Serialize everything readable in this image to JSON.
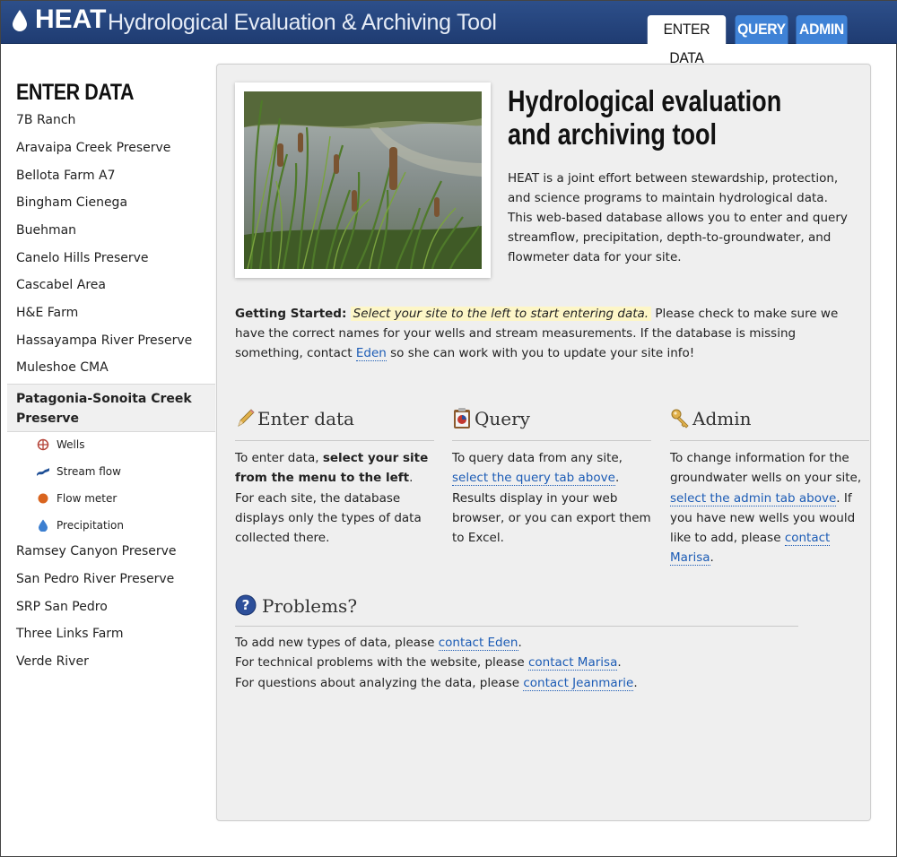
{
  "header": {
    "logo_text": "HEAT",
    "subtitle": "Hydrological Evaluation & Archiving Tool",
    "tabs": [
      {
        "label": "ENTER DATA",
        "active": true
      },
      {
        "label": "QUERY",
        "active": false
      },
      {
        "label": "ADMIN",
        "active": false
      }
    ],
    "bg_color": "#244580",
    "tab_color": "#3f82d6"
  },
  "sidebar": {
    "heading": "ENTER DATA",
    "items_before": [
      "7B Ranch",
      "Aravaipa Creek Preserve",
      "Bellota Farm A7",
      "Bingham Cienega",
      "Buehman",
      "Canelo Hills Preserve",
      "Cascabel Area",
      "H&E Farm",
      "Hassayampa River Preserve",
      "Muleshoe CMA"
    ],
    "active_item": "Patagonia-Sonoita Creek Preserve",
    "sub_items": [
      {
        "label": "Wells",
        "icon": "crosshair-circle-icon"
      },
      {
        "label": "Stream flow",
        "icon": "stream-icon"
      },
      {
        "label": "Flow meter",
        "icon": "orange-dot-icon"
      },
      {
        "label": "Precipitation",
        "icon": "raindrop-icon"
      }
    ],
    "items_after": [
      "Ramsey Canyon Preserve",
      "San Pedro River Preserve",
      "SRP San Pedro",
      "Three Links Farm",
      "Verde River"
    ]
  },
  "main": {
    "title": "Hydrological evaluation and archiving tool",
    "intro": "HEAT is a joint effort between stewardship, protection, and science programs to maintain hydrological data. This web-based database allows you to enter and query streamflow, precipitation, depth-to-groundwater, and flowmeter data for your site.",
    "getting_started": {
      "label": "Getting Started:",
      "highlight": "Select your site to the left to start entering data.",
      "text1": "Please check to make sure we have the correct names for your wells and stream measurements. If the database is missing something, contact",
      "link": "Eden",
      "text2": "so she can work with you to update your site info!"
    },
    "columns": {
      "enter": {
        "title": "Enter data",
        "icon": "pencil-icon",
        "text1": "To enter data,",
        "bold": "select your site from the menu to the left",
        "text2": ". For each site, the database displays only the types of data collected there."
      },
      "query": {
        "title": "Query",
        "icon": "clipboard-chart-icon",
        "text1": "To query data from any site,",
        "link": "select the query tab above",
        "text2": ". Results display in your web browser, or you can export them to Excel."
      },
      "admin": {
        "title": "Admin",
        "icon": "key-icon",
        "text1": "To change information for the groundwater wells on your site,",
        "link1": "select the admin tab above",
        "text2": ". If you have new wells you would like to add, please",
        "link2": "contact Marisa",
        "text3": "."
      }
    },
    "problems": {
      "title": "Problems?",
      "icon": "question-circle-icon",
      "lines": [
        {
          "text": "To add new types of data, please",
          "link": "contact Eden",
          "end": "."
        },
        {
          "text": "For technical problems with the website, please",
          "link": "contact Marisa",
          "end": "."
        },
        {
          "text": "For questions about analyzing the data, please",
          "link": "contact Jeanmarie",
          "end": "."
        }
      ]
    }
  }
}
